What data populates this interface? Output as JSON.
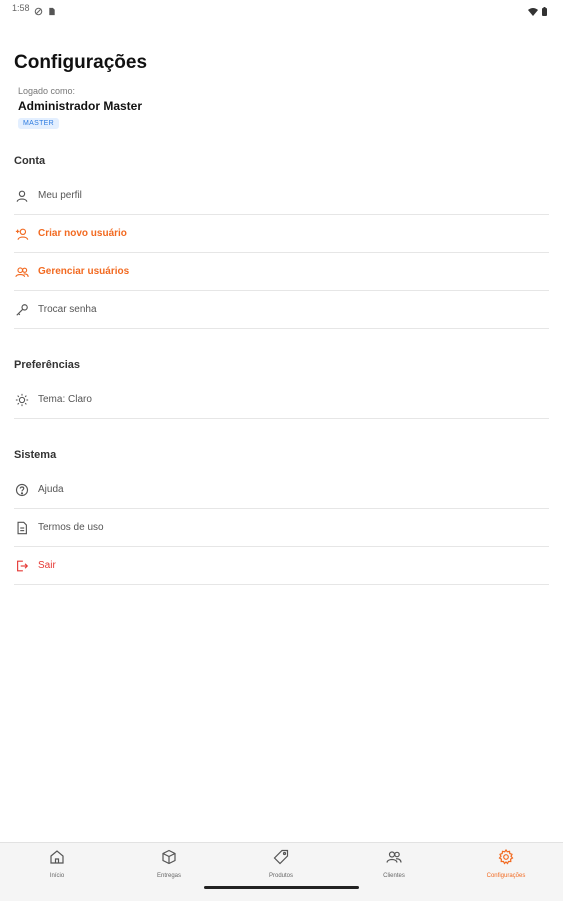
{
  "status_bar": {
    "time": "1:58"
  },
  "header": {
    "title": "Configurações",
    "logged_as_label": "Logado como:",
    "user_name": "Administrador Master",
    "role_badge": "MASTER"
  },
  "sections": {
    "conta": {
      "label": "Conta",
      "items": [
        {
          "label": "Meu perfil",
          "icon": "user-icon"
        },
        {
          "label": "Criar novo usuário",
          "icon": "user-plus-icon"
        },
        {
          "label": "Gerenciar usuários",
          "icon": "users-icon"
        },
        {
          "label": "Trocar senha",
          "icon": "key-icon"
        }
      ]
    },
    "preferencias": {
      "label": "Preferências",
      "items": [
        {
          "label": "Tema: Claro",
          "icon": "sun-icon"
        }
      ]
    },
    "sistema": {
      "label": "Sistema",
      "items": [
        {
          "label": "Ajuda",
          "icon": "help-circle-icon"
        },
        {
          "label": "Termos de uso",
          "icon": "document-icon"
        },
        {
          "label": "Sair",
          "icon": "logout-icon"
        }
      ]
    }
  },
  "bottom_nav": {
    "items": [
      {
        "label": "Início",
        "icon": "home-icon"
      },
      {
        "label": "Entregas",
        "icon": "box-icon"
      },
      {
        "label": "Produtos",
        "icon": "tag-icon"
      },
      {
        "label": "Clientes",
        "icon": "users-icon"
      },
      {
        "label": "Configurações",
        "icon": "gear-icon"
      }
    ],
    "active_index": 4
  },
  "colors": {
    "accent": "#f26a21",
    "danger": "#e53935",
    "badge_bg": "#e3efff",
    "badge_text": "#2d7be0"
  }
}
